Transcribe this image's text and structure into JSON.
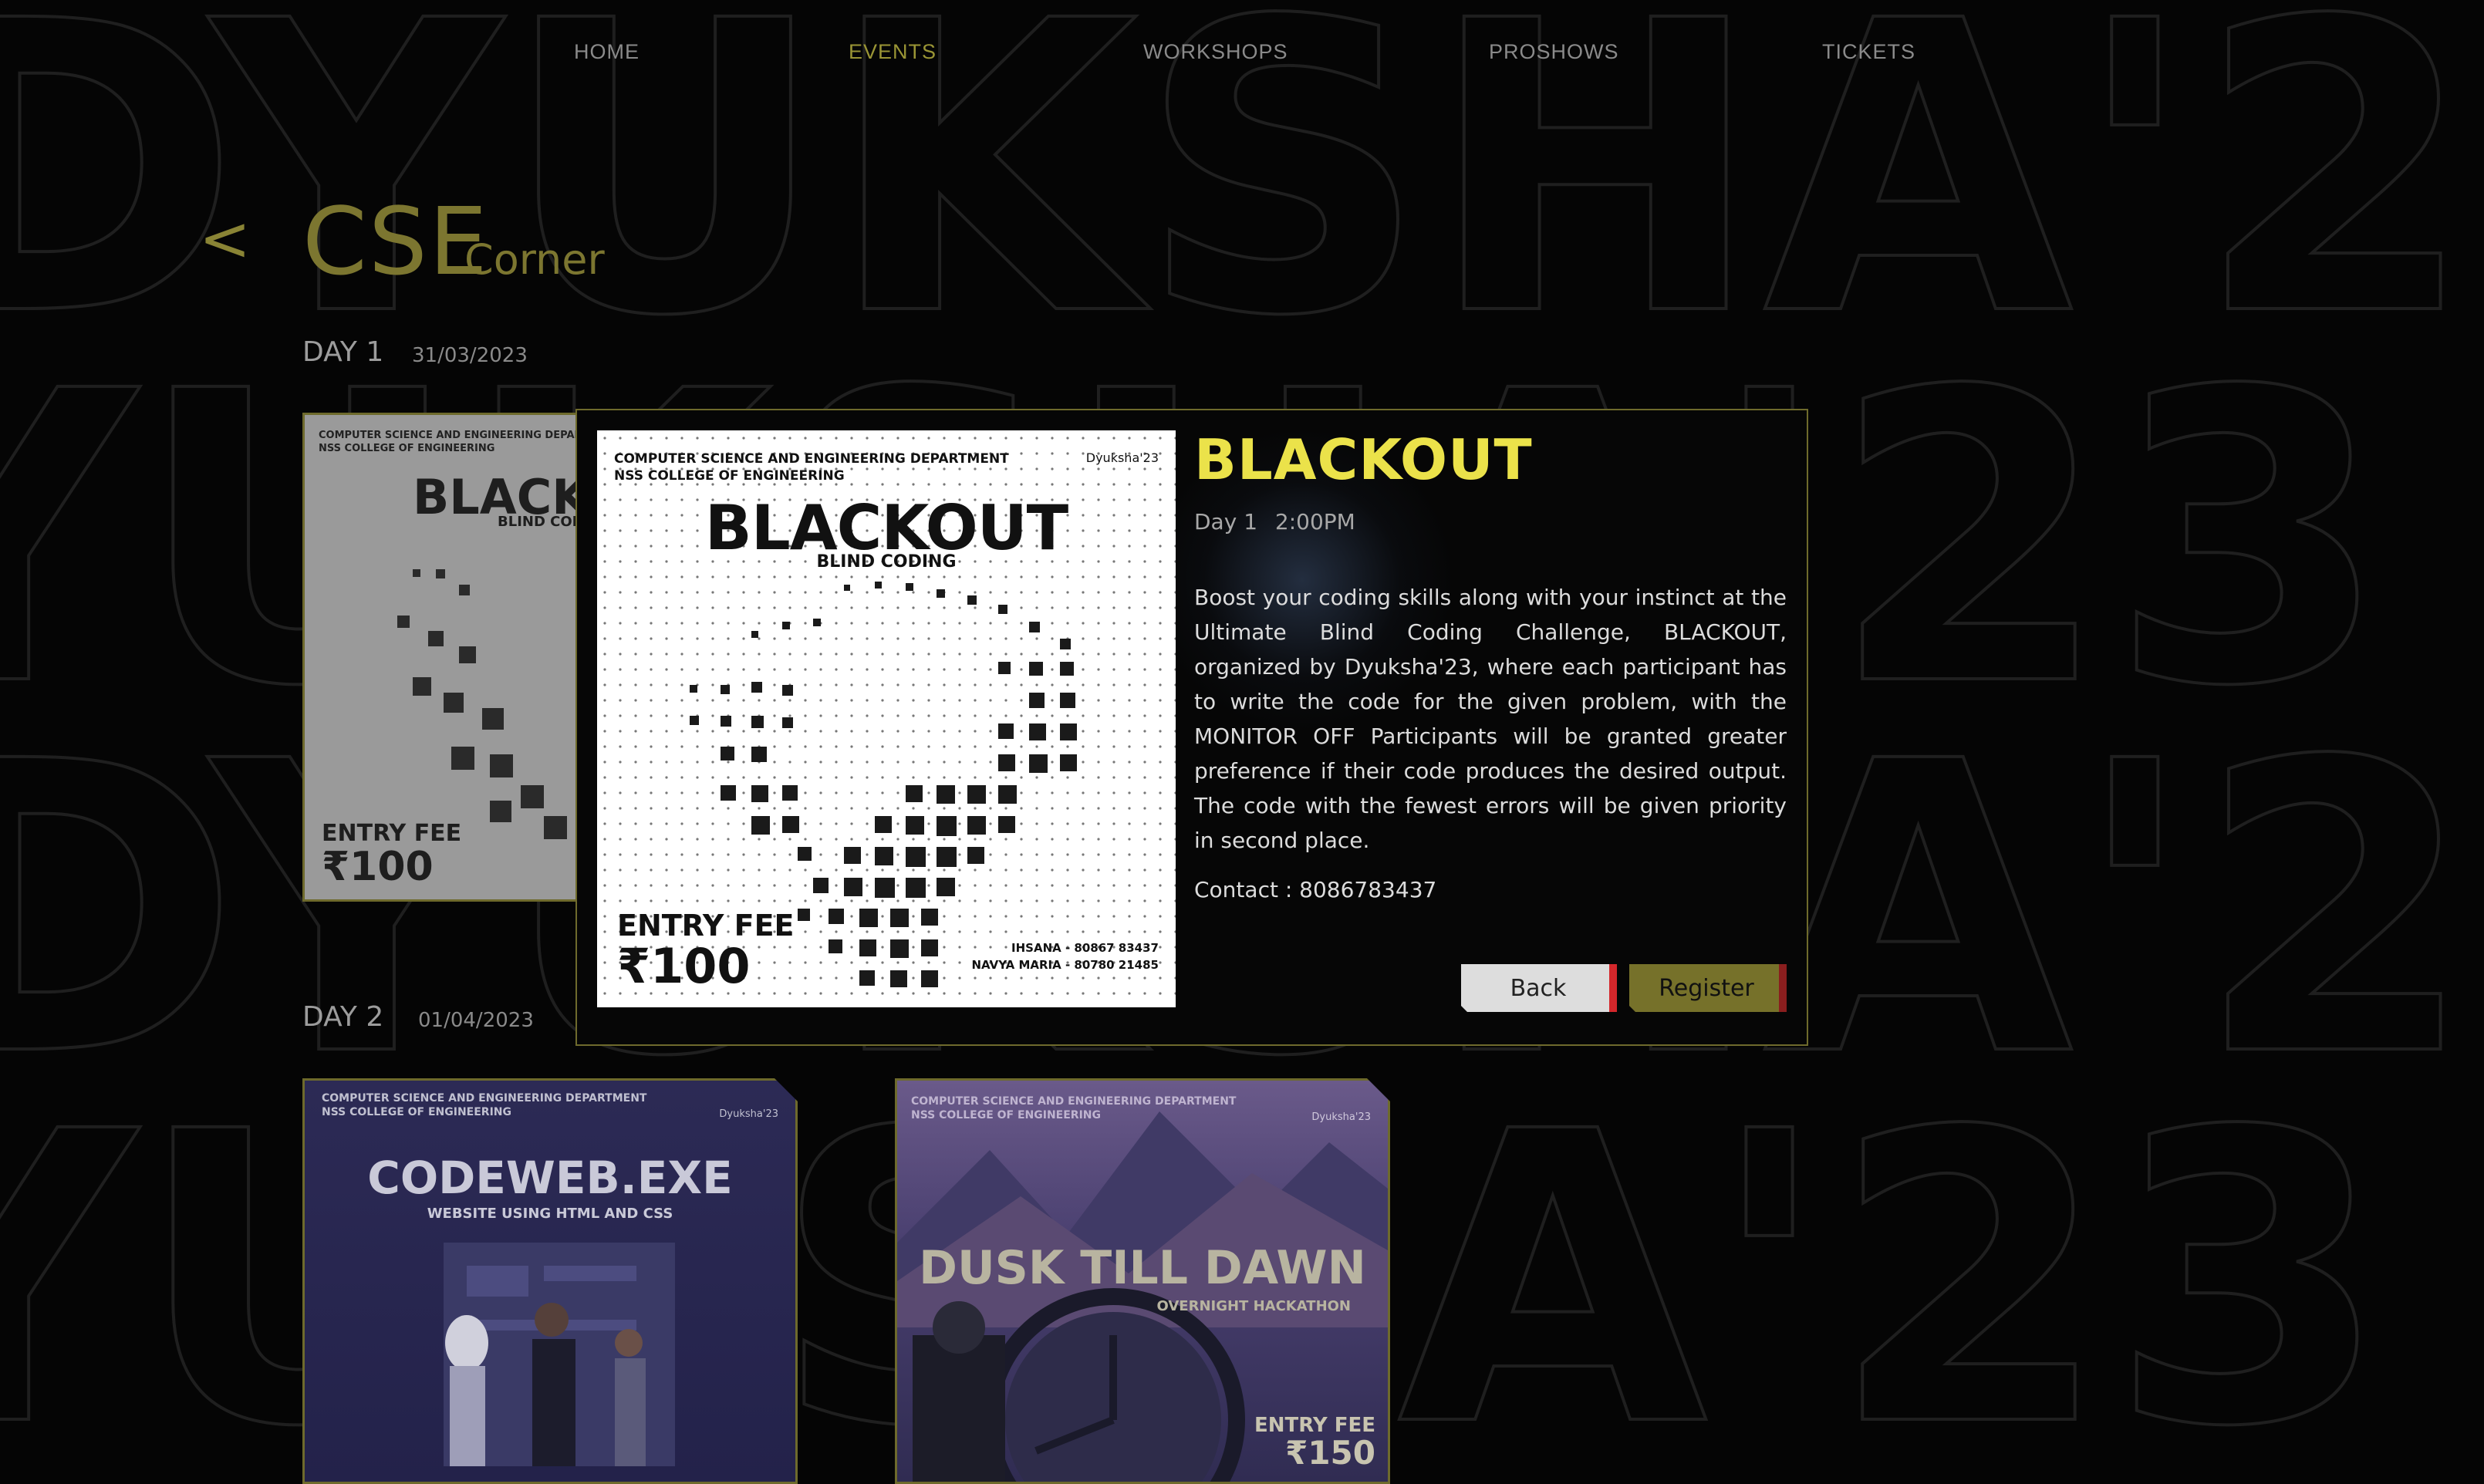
{
  "nav": {
    "items": [
      {
        "label": "HOME"
      },
      {
        "label": "EVENTS"
      },
      {
        "label": "WORKSHOPS"
      },
      {
        "label": "PROSHOWS"
      },
      {
        "label": "TICKETS"
      }
    ],
    "active": "EVENTS"
  },
  "header": {
    "back_label": "<",
    "title_main": "CSE",
    "title_sub": "Corner"
  },
  "days": [
    {
      "label": "DAY 1",
      "date": "31/03/2023"
    },
    {
      "label": "DAY 2",
      "date": "01/04/2023"
    }
  ],
  "cards": {
    "blackout": {
      "dept": "COMPUTER SCIENCE AND ENGINEERING DEPARTMENT",
      "college": "NSS COLLEGE OF ENGINEERING",
      "title": "BLACKOUT",
      "subtitle": "BLIND CODING",
      "fee_label": "ENTRY FEE",
      "fee": "₹100"
    },
    "codeweb": {
      "dept": "COMPUTER SCIENCE AND ENGINEERING DEPARTMENT",
      "college": "NSS COLLEGE OF ENGINEERING",
      "logo": "Dyuksha'23",
      "title": "CODEWEB.EXE",
      "subtitle": "WEBSITE USING HTML AND CSS"
    },
    "dusk": {
      "dept": "COMPUTER SCIENCE AND ENGINEERING DEPARTMENT",
      "college": "NSS COLLEGE OF ENGINEERING",
      "logo": "Dyuksha'23",
      "title": "DUSK TILL DAWN",
      "subtitle": "OVERNIGHT HACKATHON",
      "fee_label": "ENTRY FEE",
      "fee": "₹150"
    }
  },
  "modal": {
    "poster": {
      "dept": "COMPUTER SCIENCE AND ENGINEERING DEPARTMENT",
      "college": "NSS COLLEGE OF ENGINEERING",
      "logo": "Dyuksha'23",
      "title": "BLACKOUT",
      "subtitle": "BLIND CODING",
      "fee_label": "ENTRY FEE",
      "fee": "₹100",
      "contact1": "IHSANA - 80867 83437",
      "contact2": "NAVYA MARIA - 80780 21485"
    },
    "title": "BLACKOUT",
    "day": "Day 1",
    "time": "2:00PM",
    "description": "Boost your coding skills along with your instinct at the Ultimate Blind Coding Challenge, BLACKOUT, organized by Dyuksha'23, where each participant has to write the code for the given problem, with the MONITOR OFF Participants will be granted greater preference if their code produces the desired output. The code with the fewest errors will be given priority in second place.",
    "contact": "Contact : 8086783437",
    "back_label": "Back",
    "register_label": "Register"
  },
  "colors": {
    "accent": "#ebe24a",
    "olive": "#7c7630",
    "background": "#050505",
    "back_bar": "#d4272b"
  }
}
